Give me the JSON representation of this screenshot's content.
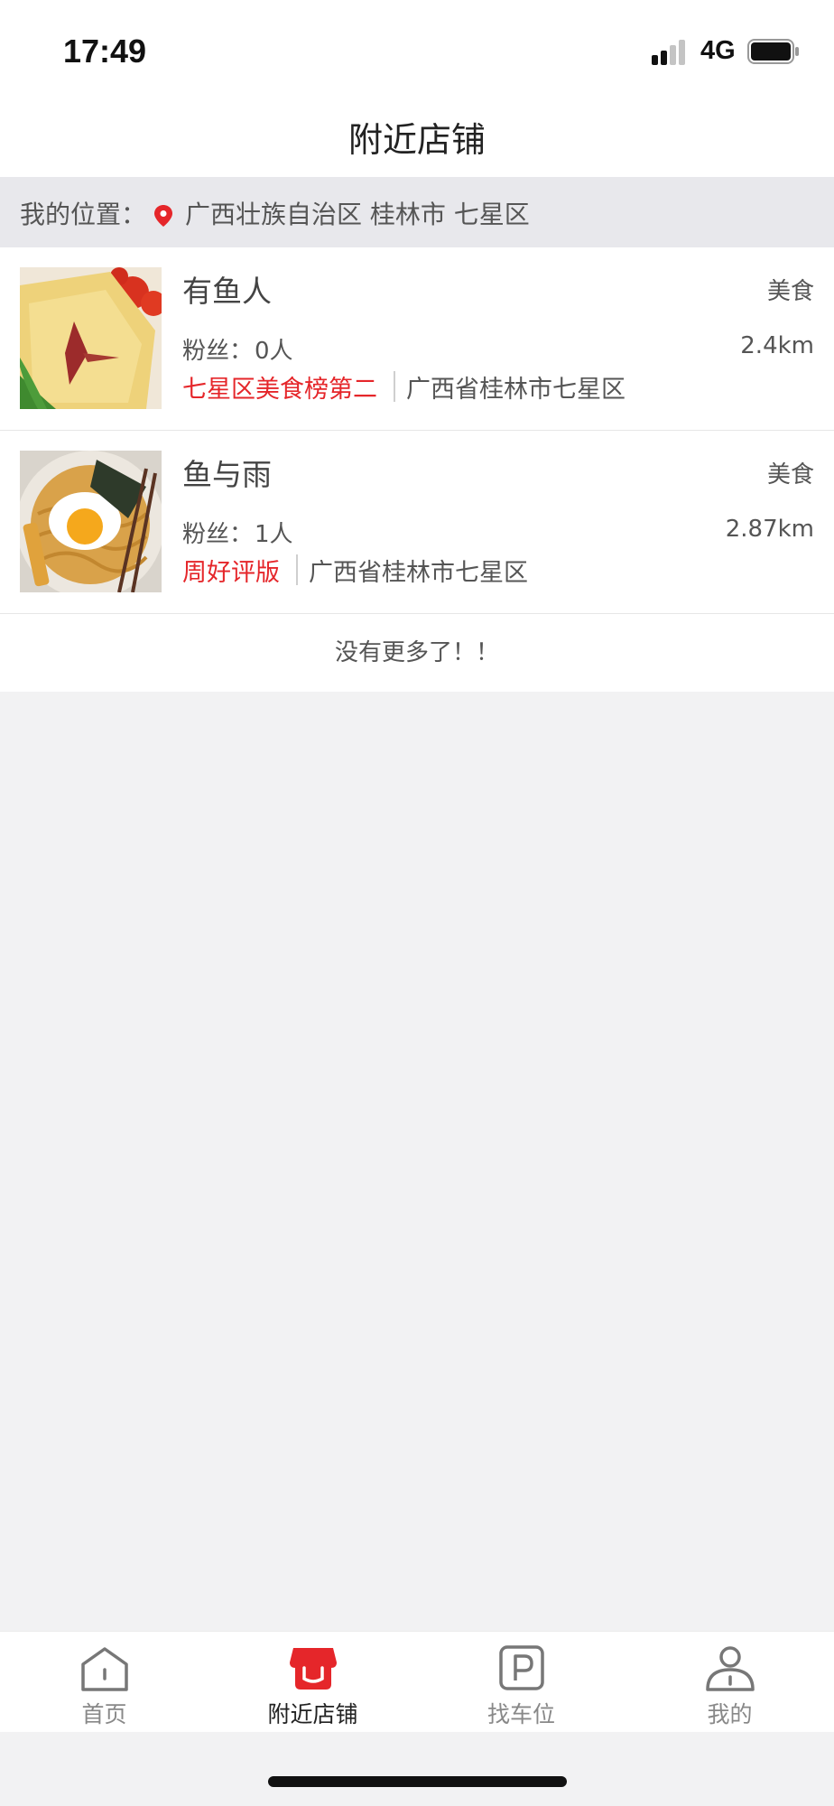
{
  "status_bar": {
    "time": "17:49",
    "network": "4G",
    "icons": [
      "signal-icon",
      "battery-icon"
    ]
  },
  "header": {
    "title": "附近店铺"
  },
  "location": {
    "label": "我的位置：",
    "value": "广西壮族自治区 桂林市 七星区",
    "icon": "location-pin-icon"
  },
  "shops": [
    {
      "name": "有鱼人",
      "category": "美食",
      "fans_label": "粉丝：",
      "fans": "0人",
      "distance": "2.4km",
      "tag": "七星区美食榜第二",
      "address": "广西省桂林市七星区",
      "image": "omelette-photo"
    },
    {
      "name": "鱼与雨",
      "category": "美食",
      "fans_label": "粉丝：",
      "fans": "1人",
      "distance": "2.87km",
      "tag": "周好评版",
      "address": "广西省桂林市七星区",
      "image": "noodle-egg-photo"
    }
  ],
  "list_footer": "没有更多了！！",
  "tab_bar": {
    "active_index": 1,
    "items": [
      {
        "label": "首页",
        "icon": "home-icon"
      },
      {
        "label": "附近店铺",
        "icon": "store-icon"
      },
      {
        "label": "找车位",
        "icon": "parking-icon"
      },
      {
        "label": "我的",
        "icon": "user-icon"
      }
    ]
  },
  "colors": {
    "accent": "#e5262a",
    "background": "#f2f2f3",
    "location_strip": "#e8e8ec"
  }
}
